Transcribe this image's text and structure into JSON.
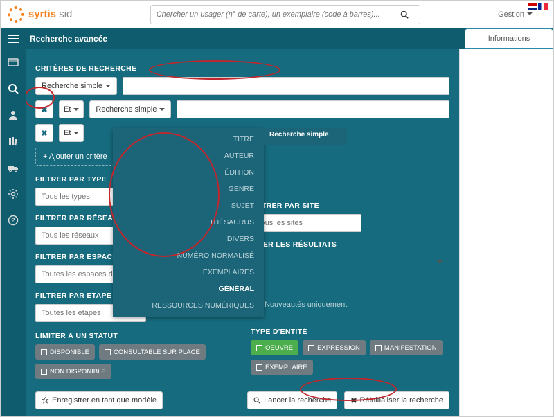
{
  "brand": {
    "name1": "syrtis",
    "name2": "sid"
  },
  "topsearch": {
    "placeholder": "Chercher un usager (n° de carte), un exemplaire (code à barres)..."
  },
  "gestion": "Gestion",
  "info_tab": "Informations",
  "breadcrumb": "Recherche avancée",
  "section_criteria": "CRITÈRES DE RECHERCHE",
  "simple_search": "Recherche simple",
  "and": "Et",
  "add_criterion": "+  Ajouter un critère",
  "filters": {
    "type": "FILTRER PAR TYPE",
    "type_ph": "Tous les types",
    "reseau": "FILTRER PAR RÉSEAU",
    "reseau_ph": "Tous les réseaux",
    "espace": "FILTRER PAR ESPACE DE DONNÉES",
    "espace_ph": "Toutes les espaces de données",
    "workflow": "FILTRER PAR ÉTAPE DE WORKFLOW",
    "workflow_ph": "Toutes les étapes",
    "site": "FILTRER PAR SITE",
    "site_ph": "Tous les sites",
    "sort": "TRIER LES RÉSULTATS",
    "nouv": "Nouveautés uniquement"
  },
  "status": {
    "title": "LIMITER À UN STATUT",
    "items": [
      "DISPONIBLE",
      "CONSULTABLE SUR PLACE",
      "NON DISPONIBLE"
    ]
  },
  "entity": {
    "title": "TYPE D'ENTITÉ",
    "items": [
      "OEUVRE",
      "EXPRESSION",
      "MANIFESTATION",
      "EXEMPLAIRE"
    ]
  },
  "actions": {
    "save": "Enregistrer en tant que modèle",
    "search": "Lancer la recherche",
    "reset": "Réinitialiser la recherche"
  },
  "popover": {
    "cats": [
      "TITRE",
      "AUTEUR",
      "ÉDITION",
      "GENRE",
      "SUJET",
      "THÉSAURUS",
      "DIVERS",
      "NUMÉRO NORMALISÉ",
      "EXEMPLAIRES",
      "GÉNÉRAL",
      "RESSOURCES NUMÉRIQUES"
    ],
    "side": "Recherche simple"
  }
}
